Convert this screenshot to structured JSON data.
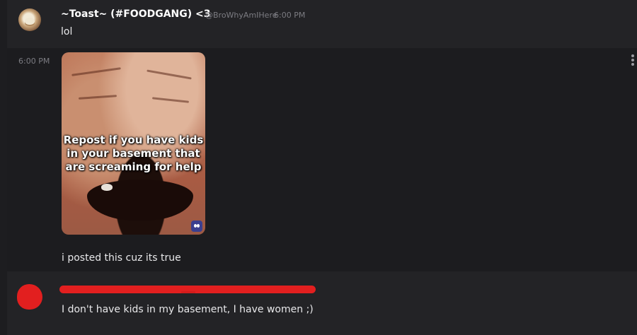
{
  "messages": [
    {
      "username": "~Toast~ (#FOODGANG) <3",
      "handle": "@BroWhyAmIHere",
      "timestamp": "6:00 PM",
      "text": "lol",
      "avatar_icon": "user-avatar"
    },
    {
      "gutter_timestamp": "6:00 PM",
      "image": {
        "caption": "Repost if you have kids in your basement that are screaming for help",
        "watermark_icon": "app-logo-icon"
      },
      "text": "i posted this cuz its true",
      "more_icon": "more-vertical-icon"
    },
    {
      "avatar_icon": "redacted-avatar",
      "text": "I don't have kids in my basement, I have women ;)"
    }
  ],
  "colors": {
    "background": "#232326",
    "hover_background": "#1c1c1f",
    "redaction": "#e21f1f",
    "text": "#e8e8ea",
    "muted": "#7c7c82"
  }
}
